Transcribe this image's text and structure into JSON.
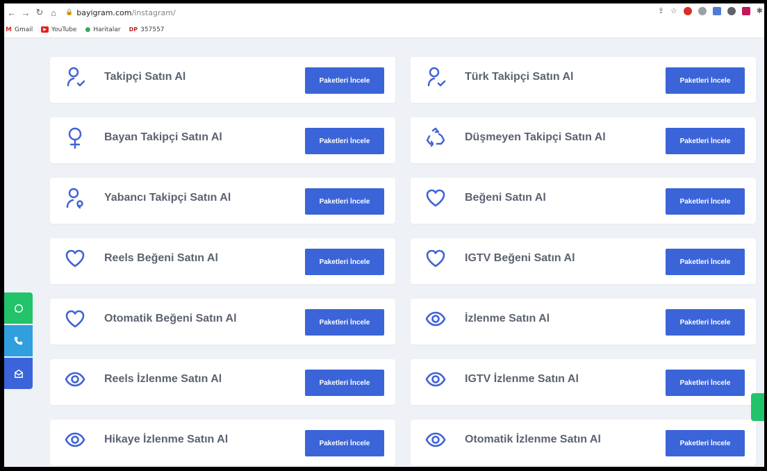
{
  "browser": {
    "url_domain": "bayigram.com",
    "url_path": "/instagram/",
    "bookmarks": [
      {
        "label": "Gmail",
        "icon": "gmail-icon"
      },
      {
        "label": "YouTube",
        "icon": "youtube-icon"
      },
      {
        "label": "Haritalar",
        "icon": "maps-pin-icon"
      },
      {
        "label": "357557",
        "icon": "dp-icon",
        "badge": "DP"
      }
    ]
  },
  "services": [
    {
      "title": "Takipçi Satın Al",
      "icon": "user-check-icon",
      "button": "Paketleri İncele"
    },
    {
      "title": "Türk Takipçi Satın Al",
      "icon": "user-check-icon",
      "button": "Paketleri İncele"
    },
    {
      "title": "Bayan Takipçi Satın Al",
      "icon": "female-icon",
      "button": "Paketleri İncele"
    },
    {
      "title": "Düşmeyen Takipçi Satın Al",
      "icon": "recycle-icon",
      "button": "Paketleri İncele"
    },
    {
      "title": "Yabancı Takipçi Satın Al",
      "icon": "user-location-icon",
      "button": "Paketleri İncele"
    },
    {
      "title": "Beğeni Satın Al",
      "icon": "heart-icon",
      "button": "Paketleri İncele"
    },
    {
      "title": "Reels Beğeni Satın Al",
      "icon": "heart-icon",
      "button": "Paketleri İncele"
    },
    {
      "title": "IGTV Beğeni Satın Al",
      "icon": "heart-icon",
      "button": "Paketleri İncele"
    },
    {
      "title": "Otomatik Beğeni Satın Al",
      "icon": "heart-icon",
      "button": "Paketleri İncele"
    },
    {
      "title": "İzlenme Satın Al",
      "icon": "eye-icon",
      "button": "Paketleri İncele"
    },
    {
      "title": "Reels İzlenme Satın Al",
      "icon": "eye-icon",
      "button": "Paketleri İncele"
    },
    {
      "title": "IGTV İzlenme Satın Al",
      "icon": "eye-icon",
      "button": "Paketleri İncele"
    },
    {
      "title": "Hikaye İzlenme Satın Al",
      "icon": "eye-icon",
      "button": "Paketleri İncele"
    },
    {
      "title": "Otomatik İzlenme Satın Al",
      "icon": "eye-icon",
      "button": "Paketleri İncele"
    }
  ],
  "side_buttons": [
    {
      "icon": "whatsapp-icon"
    },
    {
      "icon": "phone-icon"
    },
    {
      "icon": "mail-icon"
    }
  ],
  "colors": {
    "accent": "#3a64d8",
    "background": "#eef1f6",
    "whatsapp": "#22c36a",
    "phone": "#2f9fdd"
  }
}
